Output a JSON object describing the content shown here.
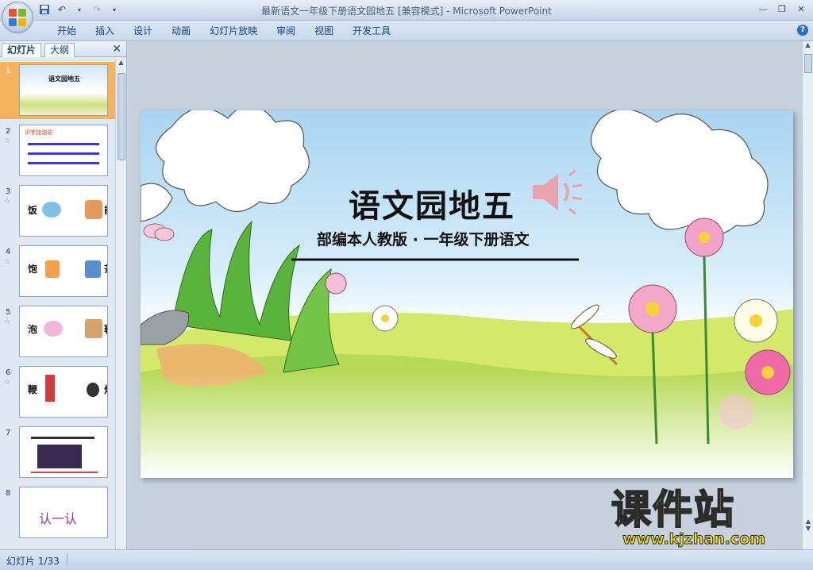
{
  "window": {
    "title": "最新语文一年级下册语文园地五 [兼容模式] - Microsoft PowerPoint"
  },
  "ribbon": {
    "tabs": [
      "开始",
      "插入",
      "设计",
      "动画",
      "幻灯片放映",
      "审阅",
      "视图",
      "开发工具"
    ]
  },
  "left_pane": {
    "tabs": [
      "幻灯片",
      "大纲"
    ],
    "close_label": "✕",
    "thumbnails": [
      {
        "number": "1",
        "text": "语文园地五"
      },
      {
        "number": "2",
        "text": "识字加油站"
      },
      {
        "number": "3",
        "text": "饭 能"
      },
      {
        "number": "4",
        "text": "饱 茶"
      },
      {
        "number": "5",
        "text": "泡 鞋"
      },
      {
        "number": "6",
        "text": "鞭 炮"
      },
      {
        "number": "7",
        "text": ""
      },
      {
        "number": "8",
        "text": "认一认"
      }
    ]
  },
  "slide": {
    "title": "语文园地五",
    "subtitle": "部编本人教版 · 一年级下册语文"
  },
  "status": {
    "slide_indicator": "幻灯片 1/33"
  },
  "watermark": {
    "brand": "课件站",
    "url": "www.kjzhan.com"
  },
  "colors": {
    "accent_selected": "#f6b45e",
    "watermark": "#f7e600"
  }
}
